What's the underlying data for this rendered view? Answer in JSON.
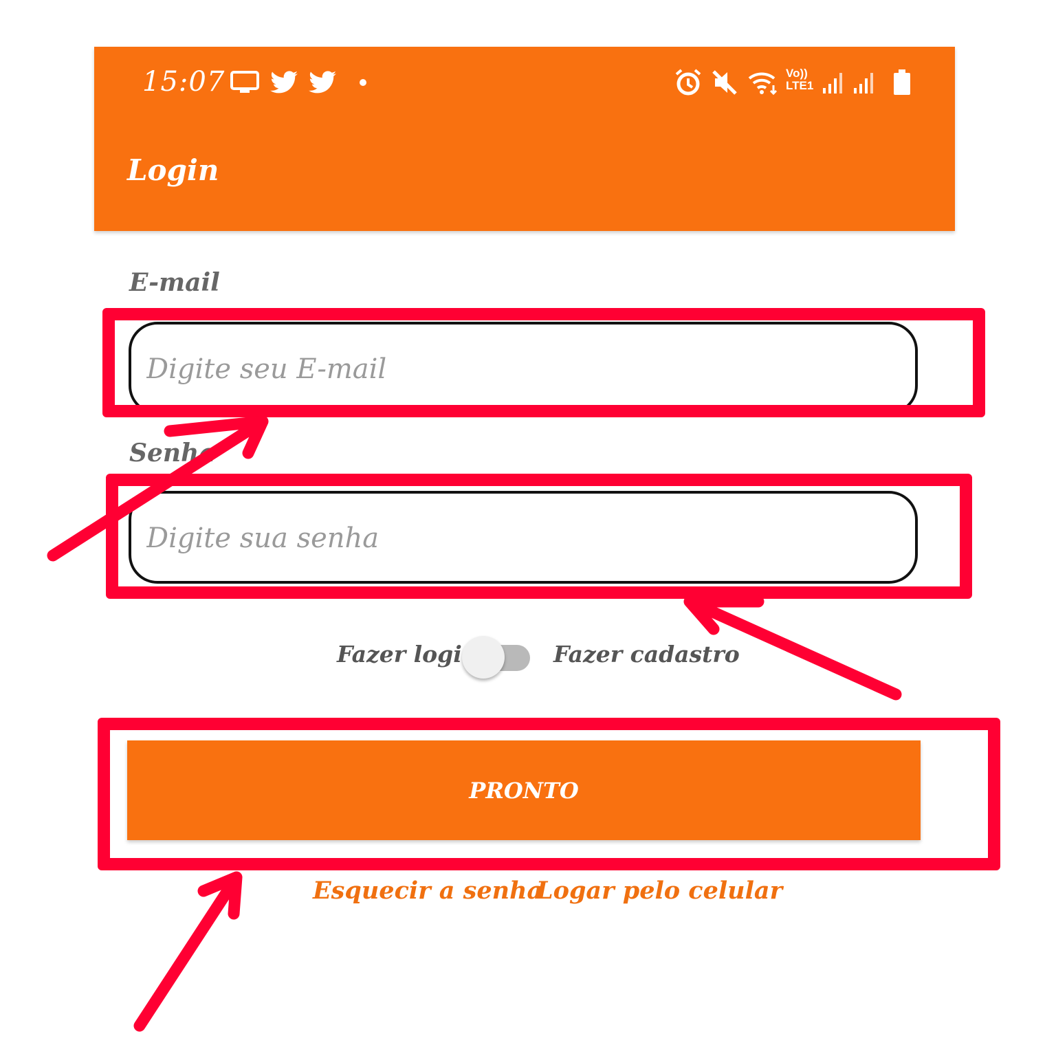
{
  "status_bar": {
    "time": "15:07",
    "left_icons": [
      "tv-icon",
      "twitter-icon",
      "twitter-icon",
      "notification-dot-icon"
    ],
    "right_icons": [
      "alarm-icon",
      "mute-icon",
      "wifi-icon",
      "volte-icon",
      "signal-icon",
      "signal-icon",
      "battery-icon"
    ],
    "volte_top": "Vo))",
    "volte_bottom": "LTE1"
  },
  "app_bar": {
    "title": "Login"
  },
  "email": {
    "label": "E-mail",
    "placeholder": "Digite seu E-mail",
    "value": ""
  },
  "password": {
    "label": "Senha",
    "placeholder": "Digite sua senha",
    "value": ""
  },
  "mode_toggle": {
    "left_label": "Fazer login",
    "right_label": "Fazer cadastro",
    "checked": false
  },
  "submit_button": {
    "label": "PRONTO"
  },
  "links": {
    "forgot_password": "Esquecir a senha",
    "phone_login": "Logar pelo celular"
  },
  "colors": {
    "primary": "#F97110",
    "annotation": "#FF0033",
    "link": "#F07010",
    "label_gray": "#666666"
  }
}
